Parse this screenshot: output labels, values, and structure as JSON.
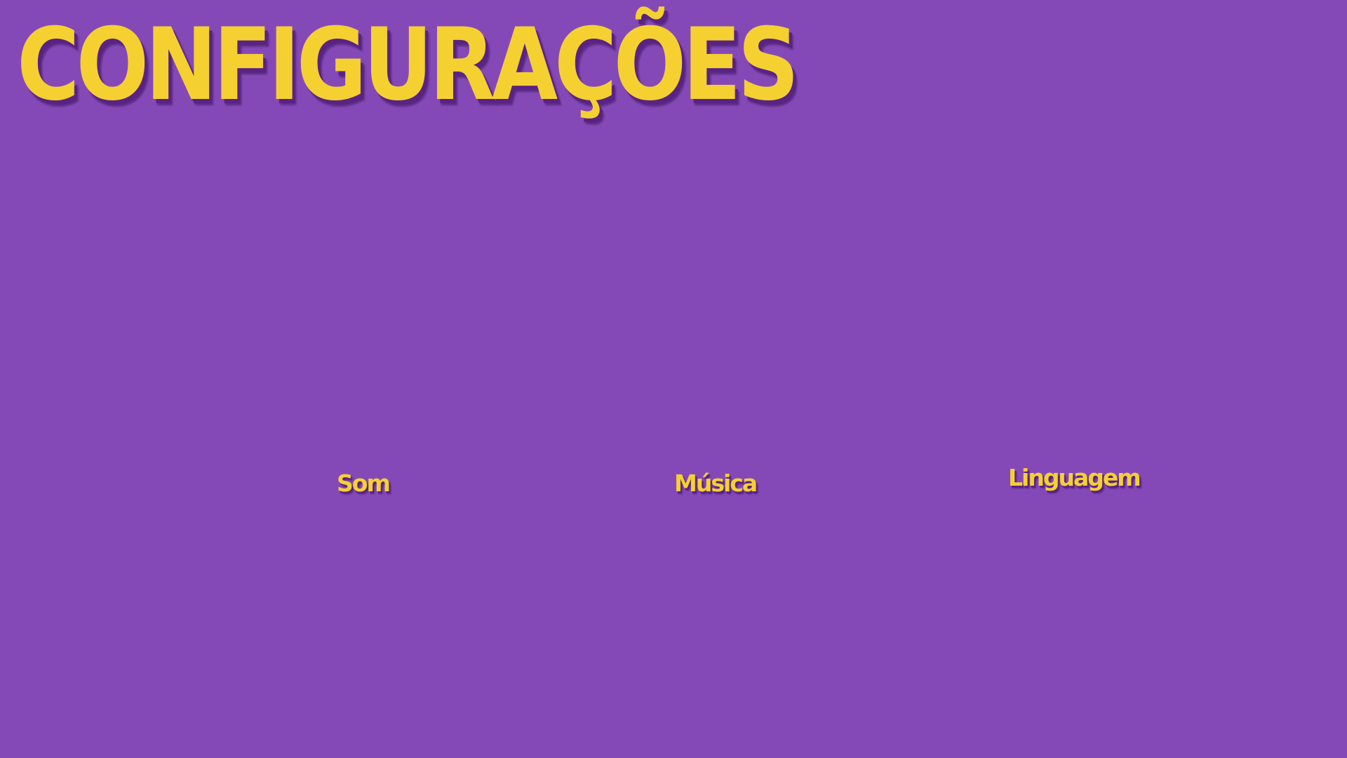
{
  "screen": {
    "title": "CONFIGURAÇÕES"
  },
  "options": {
    "sound_label": "Som",
    "music_label": "Música",
    "language_label": "Linguagem"
  },
  "colors": {
    "background": "#8549B7",
    "text": "#F4D131",
    "shadow": "#5A2285"
  }
}
